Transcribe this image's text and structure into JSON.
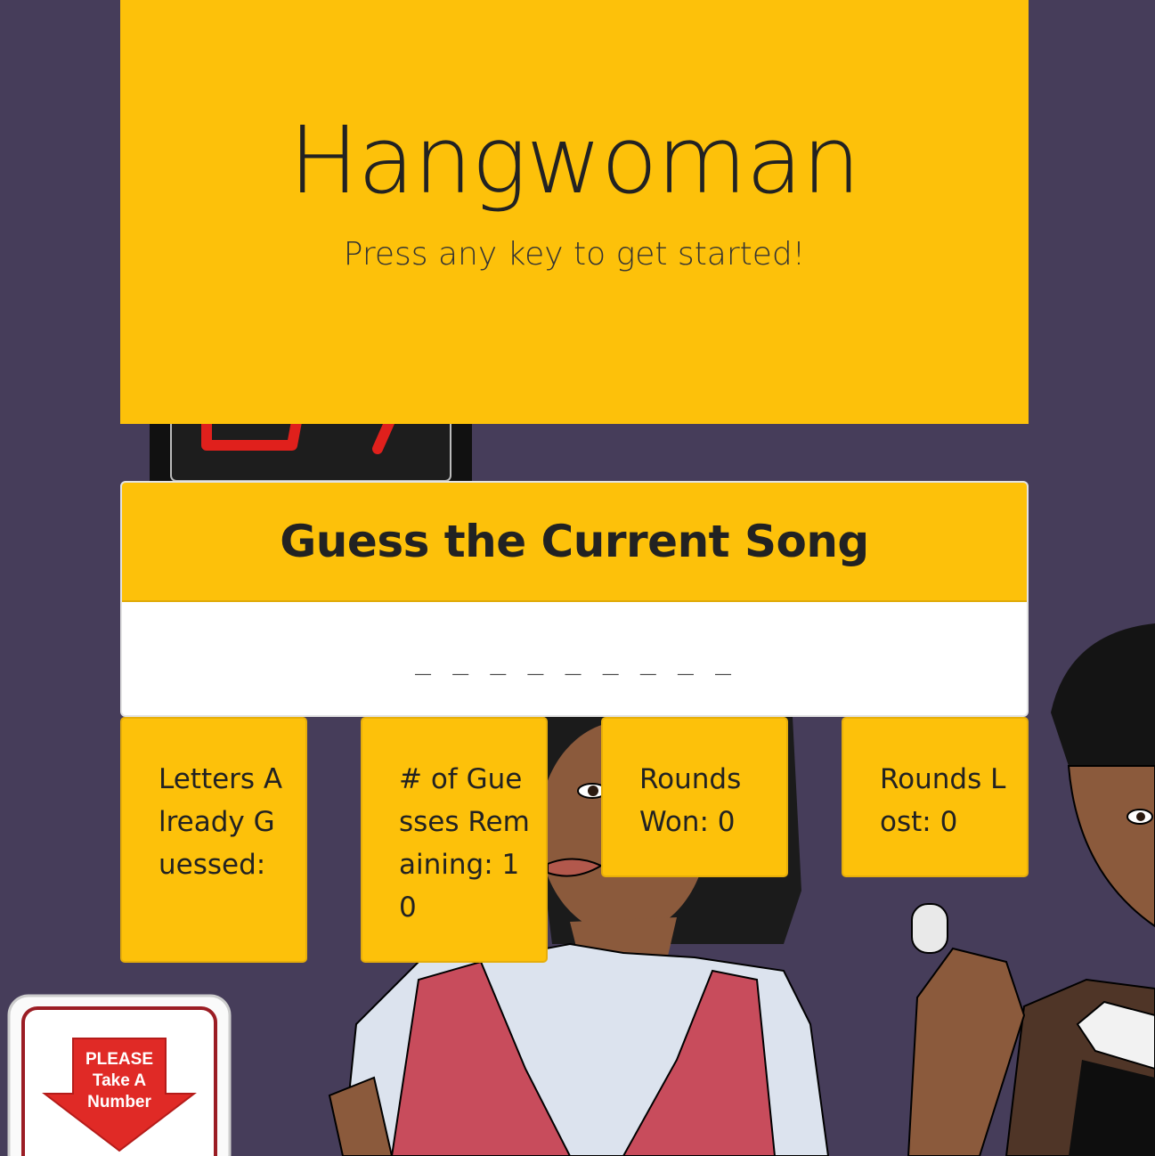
{
  "jumbotron": {
    "title": "Hangwoman",
    "subtitle": "Press any key to get started!"
  },
  "song_card": {
    "header": "Guess the Current Song",
    "blanks": "_ _ _ _ _ _ _ _ _"
  },
  "stats": {
    "letters_guessed": "Letters Already Guessed:",
    "guesses_remaining": "# of Guesses Remaining: 10",
    "rounds_won": "Rounds Won: 0",
    "rounds_lost": "Rounds Lost: 0"
  },
  "sign": {
    "text": "PLEASE Take A Number"
  },
  "colors": {
    "background": "#463d5a",
    "accent_yellow": "#fdc10a",
    "card_white": "#ffffff"
  }
}
